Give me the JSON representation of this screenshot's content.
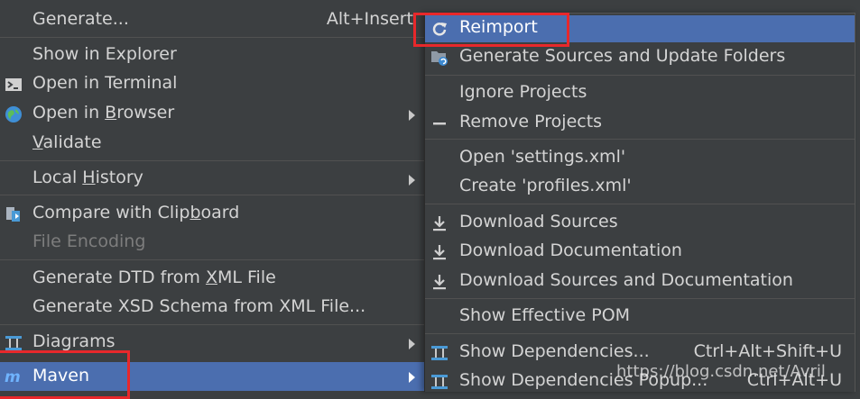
{
  "colors": {
    "background": "#3c3f41",
    "selected": "#4b6eaf",
    "text": "#d4d4d4",
    "disabled_text": "#7d7d7d",
    "highlight_box": "#e8282b"
  },
  "left_menu": {
    "generate": {
      "label": "Generate...",
      "shortcut": "Alt+Insert"
    },
    "show_in_explorer": {
      "label": "Show in Explorer"
    },
    "open_in_terminal": {
      "label": "Open in Terminal",
      "icon": "terminal-icon"
    },
    "open_in_browser": {
      "label_pre": "Open in ",
      "label_mn": "B",
      "label_post": "rowser",
      "icon": "globe-icon"
    },
    "validate": {
      "label_mn": "V",
      "label_post": "alidate"
    },
    "local_history": {
      "label_pre": "Local ",
      "label_mn": "H",
      "label_post": "istory"
    },
    "compare_clipboard": {
      "label_pre": "Compare with Clip",
      "label_mn": "b",
      "label_post": "oard",
      "icon": "compare-icon"
    },
    "file_encoding": {
      "label": "File Encoding"
    },
    "generate_dtd": {
      "label_pre": "Generate DTD from ",
      "label_mn": "X",
      "label_post": "ML File"
    },
    "generate_xsd": {
      "label": "Generate XSD Schema from XML File..."
    },
    "diagrams": {
      "label": "Diagrams",
      "icon": "diagram-icon"
    },
    "maven": {
      "label": "Maven",
      "icon": "maven-icon"
    }
  },
  "right_menu": {
    "reimport": {
      "label": "Reimport",
      "icon": "refresh-icon"
    },
    "generate_sources": {
      "label": "Generate Sources and Update Folders",
      "icon": "folder-refresh-icon"
    },
    "ignore_projects": {
      "label": "Ignore Projects"
    },
    "remove_projects": {
      "label": "Remove Projects",
      "icon": "minus-icon"
    },
    "open_settings": {
      "label": "Open 'settings.xml'"
    },
    "create_profiles": {
      "label": "Create 'profiles.xml'"
    },
    "download_sources": {
      "label": "Download Sources",
      "icon": "download-icon"
    },
    "download_docs": {
      "label": "Download Documentation",
      "icon": "download-icon"
    },
    "download_both": {
      "label": "Download Sources and Documentation",
      "icon": "download-icon"
    },
    "show_pom": {
      "label": "Show Effective POM"
    },
    "show_deps": {
      "label": "Show Dependencies...",
      "shortcut": "Ctrl+Alt+Shift+U",
      "icon": "dependencies-icon"
    },
    "show_deps_popup": {
      "label": "Show Dependencies Popup...",
      "shortcut": "Ctrl+Alt+U",
      "icon": "dependencies-icon"
    }
  },
  "watermark": "https://blog.csdn.net/Avril"
}
